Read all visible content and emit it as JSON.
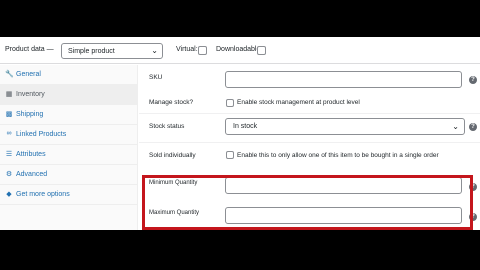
{
  "header": {
    "title": "Product data —",
    "product_type": "Simple product",
    "virtual_label": "Virtual:",
    "downloadable_label": "Downloadable:"
  },
  "sidebar": {
    "items": [
      {
        "label": "General",
        "icon": "wrench-icon"
      },
      {
        "label": "Inventory",
        "icon": "clipboard-icon"
      },
      {
        "label": "Shipping",
        "icon": "truck-icon"
      },
      {
        "label": "Linked Products",
        "icon": "link-icon"
      },
      {
        "label": "Attributes",
        "icon": "list-icon"
      },
      {
        "label": "Advanced",
        "icon": "gear-icon"
      },
      {
        "label": "Get more options",
        "icon": "plugin-icon"
      }
    ]
  },
  "fields": {
    "sku_label": "SKU",
    "manage_stock_label": "Manage stock?",
    "manage_stock_text": "Enable stock management at product level",
    "stock_status_label": "Stock status",
    "stock_status_value": "In stock",
    "sold_individually_label": "Sold individually",
    "sold_individually_text": "Enable this to only allow one of this item to be bought in a single order",
    "min_qty_label": "Minimum Quantity",
    "max_qty_label": "Maximum Quantity",
    "help_glyph": "?"
  },
  "colors": {
    "highlight": "#c4161c",
    "link": "#2271b1"
  }
}
